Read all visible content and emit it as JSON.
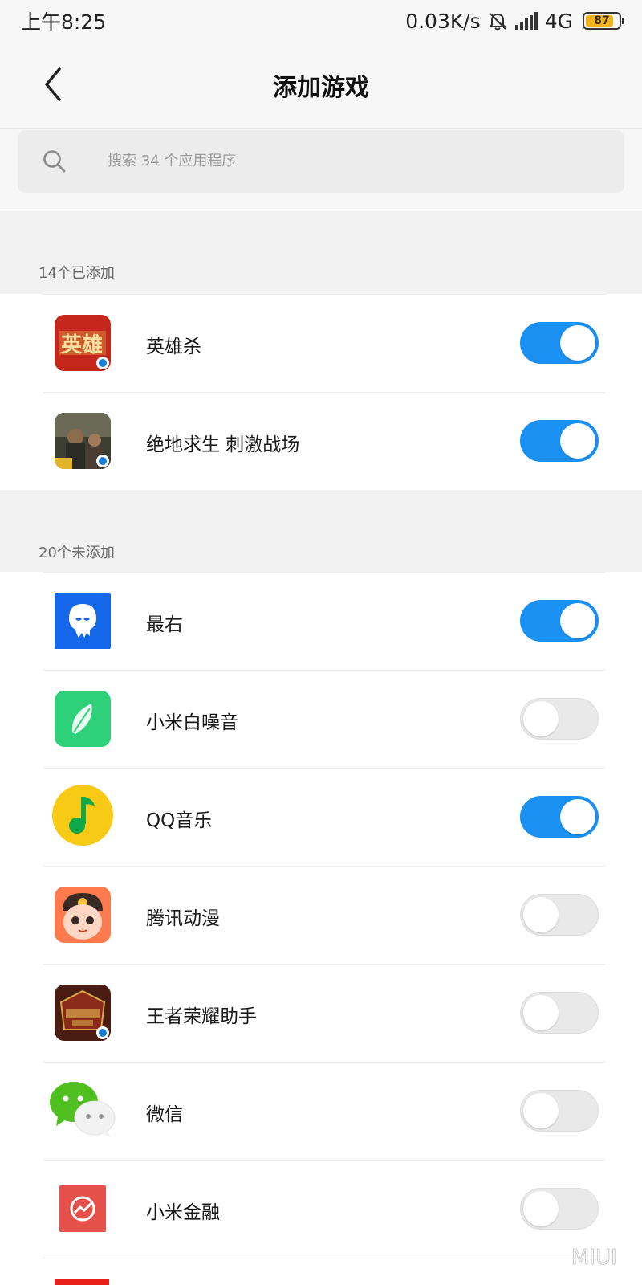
{
  "status_bar": {
    "time": "上午8:25",
    "net_speed": "0.03K/s",
    "network": "4G",
    "battery": "87",
    "battery_level": 0.87
  },
  "header": {
    "title": "添加游戏",
    "back_icon": "chevron-left-icon"
  },
  "search": {
    "placeholder": "搜索 34 个应用程序",
    "icon": "search-icon"
  },
  "sections": [
    {
      "label": "14个已添加",
      "items": [
        {
          "name": "英雄杀",
          "enabled": true,
          "icon": "yingxiongsha-app-icon"
        },
        {
          "name": "绝地求生 刺激战场",
          "enabled": true,
          "icon": "pubg-app-icon"
        }
      ]
    },
    {
      "label": "20个未添加",
      "items": [
        {
          "name": "最右",
          "enabled": true,
          "icon": "zuiyou-app-icon"
        },
        {
          "name": "小米白噪音",
          "enabled": false,
          "icon": "white-noise-app-icon"
        },
        {
          "name": "QQ音乐",
          "enabled": true,
          "icon": "qq-music-app-icon"
        },
        {
          "name": "腾讯动漫",
          "enabled": false,
          "icon": "tencent-comic-app-icon"
        },
        {
          "name": "王者荣耀助手",
          "enabled": false,
          "icon": "wangzhe-helper-app-icon"
        },
        {
          "name": "微信",
          "enabled": false,
          "icon": "wechat-app-icon"
        },
        {
          "name": "小米金融",
          "enabled": false,
          "icon": "mi-finance-app-icon"
        }
      ]
    }
  ],
  "colors": {
    "toggle_on": "#1a91f2",
    "toggle_off": "#e9e9e9",
    "battery": "#f2b41b"
  }
}
